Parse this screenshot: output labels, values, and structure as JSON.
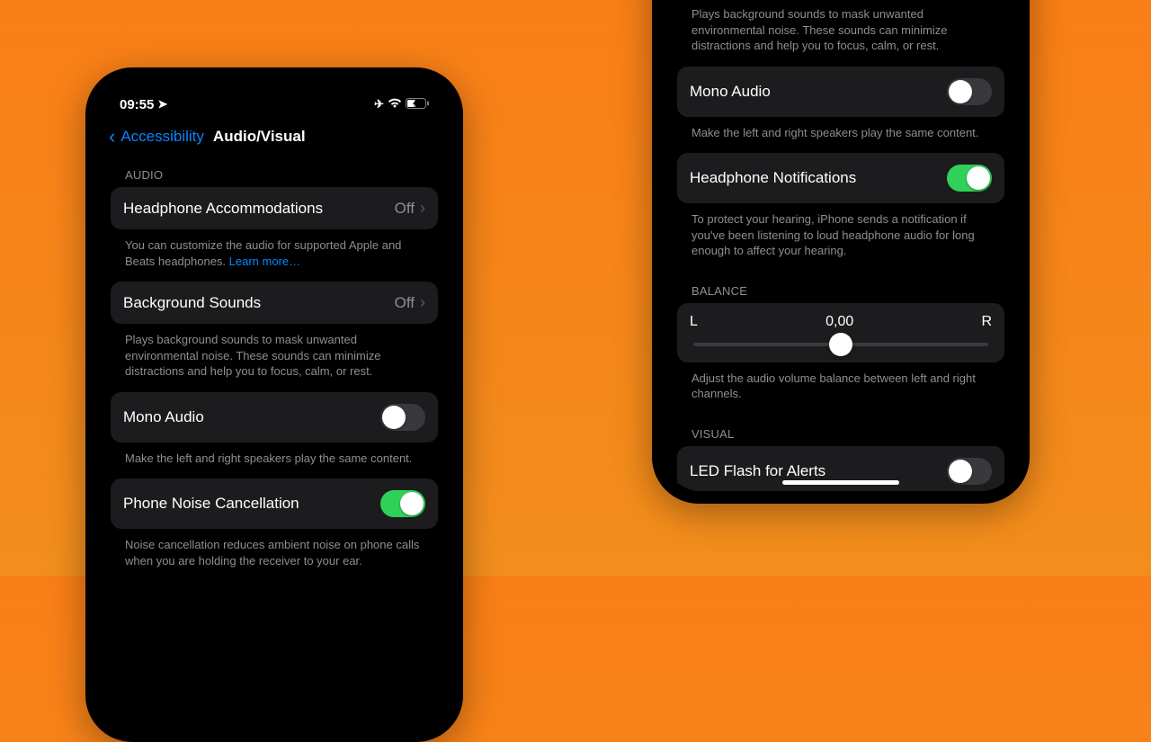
{
  "status": {
    "time": "09:55"
  },
  "nav": {
    "back": "Accessibility",
    "title": "Audio/Visual"
  },
  "left": {
    "section_audio": "AUDIO",
    "headphone_acc": {
      "label": "Headphone Accommodations",
      "value": "Off"
    },
    "headphone_foot": "You can customize the audio for supported Apple and Beats headphones. ",
    "learn_more": "Learn more…",
    "bg_sounds": {
      "label": "Background Sounds",
      "value": "Off"
    },
    "bg_sounds_foot": "Plays background sounds to mask unwanted environmental noise. These sounds can minimize distractions and help you to focus, calm, or rest.",
    "mono": {
      "label": "Mono Audio"
    },
    "mono_foot": "Make the left and right speakers play the same content.",
    "noise": {
      "label": "Phone Noise Cancellation"
    },
    "noise_foot": "Noise cancellation reduces ambient noise on phone calls when you are holding the receiver to your ear."
  },
  "right": {
    "bg_sounds_foot": "Plays background sounds to mask unwanted environmental noise. These sounds can minimize distractions and help you to focus, calm, or rest.",
    "mono": {
      "label": "Mono Audio"
    },
    "mono_foot": "Make the left and right speakers play the same content.",
    "head_notif": {
      "label": "Headphone Notifications"
    },
    "head_notif_foot": "To protect your hearing, iPhone sends a notification if you've been listening to loud headphone audio for long enough to affect your hearing.",
    "balance_header": "BALANCE",
    "balance_L": "L",
    "balance_val": "0,00",
    "balance_R": "R",
    "balance_foot": "Adjust the audio volume balance between left and right channels.",
    "visual_header": "VISUAL",
    "led": {
      "label": "LED Flash for Alerts"
    }
  }
}
